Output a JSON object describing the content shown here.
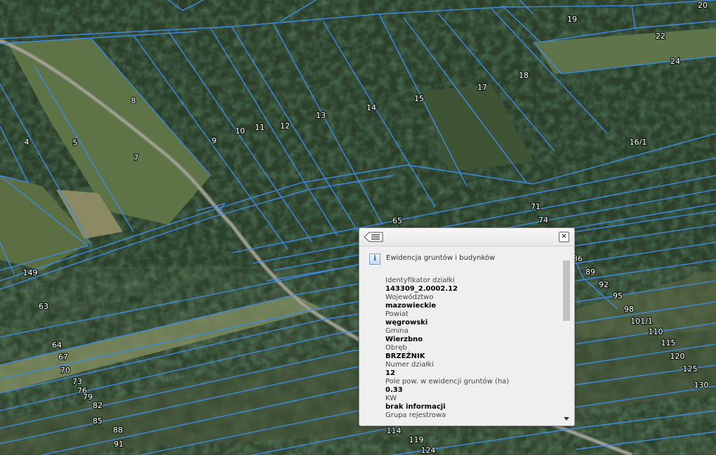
{
  "map": {
    "parcel_labels": [
      "20",
      "19",
      "22",
      "24",
      "18",
      "17",
      "15",
      "14",
      "13",
      "12",
      "11",
      "10",
      "9",
      "8",
      "7",
      "5",
      "4",
      "16/1",
      "71",
      "74",
      "65",
      "149",
      "63",
      "64",
      "67",
      "70",
      "73",
      "76",
      "79",
      "82",
      "85",
      "88",
      "91",
      "86",
      "89",
      "92",
      "95",
      "98",
      "101/1",
      "110",
      "115",
      "120",
      "125",
      "130",
      "114",
      "119",
      "124"
    ],
    "line_color": "#3d8be8"
  },
  "popup": {
    "layer_title": "Ewidencja gruntów i budynków",
    "fields": [
      {
        "label": "Identyfikator działki",
        "value": "143309_2.0002.12"
      },
      {
        "label": "Województwo",
        "value": "mazowieckie"
      },
      {
        "label": "Powiat",
        "value": "węgrowski"
      },
      {
        "label": "Gmina",
        "value": "Wierzbno"
      },
      {
        "label": "Obręb",
        "value": "BRZEŹNIK"
      },
      {
        "label": "Numer działki",
        "value": "12"
      },
      {
        "label": "Pole pow. w ewidencji gruntów (ha)",
        "value": "0.33"
      },
      {
        "label": "KW",
        "value": "brak informacji"
      },
      {
        "label": "Grupa rejestrowa",
        "value": ""
      }
    ],
    "icons": {
      "back": "back-list-icon",
      "close": "close-icon",
      "info": "info-icon"
    }
  }
}
